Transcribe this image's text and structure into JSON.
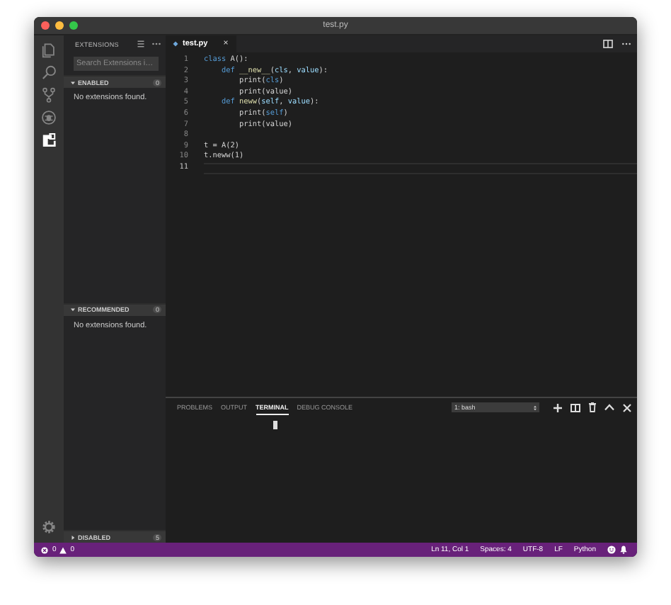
{
  "window": {
    "title": "test.py"
  },
  "activity_bar": {
    "items": [
      {
        "kind": "files",
        "selected": false
      },
      {
        "kind": "search",
        "selected": false
      },
      {
        "kind": "git",
        "selected": false
      },
      {
        "kind": "debug",
        "selected": false
      },
      {
        "kind": "extensions",
        "selected": true
      }
    ]
  },
  "sidebar": {
    "title": "EXTENSIONS",
    "search": {
      "placeholder": "Search Extensions i…"
    },
    "sections": [
      {
        "label": "ENABLED",
        "count": "0",
        "expanded": true,
        "message": "No extensions found."
      },
      {
        "label": "RECOMMENDED",
        "count": "0",
        "expanded": true,
        "message": "No extensions found."
      },
      {
        "label": "DISABLED",
        "count": "5",
        "expanded": false
      }
    ]
  },
  "editor": {
    "tabs": [
      {
        "label": "test.py",
        "close": "×",
        "selected": true
      }
    ],
    "lines": [
      {
        "number": "1",
        "tokens": [
          {
            "text": "class",
            "kind": "keyword"
          },
          {
            "text": " A():",
            "kind": "plain"
          }
        ]
      },
      {
        "number": "2",
        "tokens": [
          {
            "text": "    def",
            "kind": "keyword"
          },
          {
            "text": " __new__",
            "kind": "function"
          },
          {
            "text": "(",
            "kind": "plain"
          },
          {
            "text": "cls",
            "kind": "param"
          },
          {
            "text": ", ",
            "kind": "plain"
          },
          {
            "text": "value",
            "kind": "param"
          },
          {
            "text": "):",
            "kind": "plain"
          }
        ]
      },
      {
        "number": "3",
        "tokens": [
          {
            "text": "        print(",
            "kind": "plain"
          },
          {
            "text": "cls",
            "kind": "self"
          },
          {
            "text": ")",
            "kind": "plain"
          }
        ]
      },
      {
        "number": "4",
        "tokens": [
          {
            "text": "        print(value)",
            "kind": "plain"
          }
        ]
      },
      {
        "number": "5",
        "tokens": [
          {
            "text": "    def",
            "kind": "keyword"
          },
          {
            "text": " neww",
            "kind": "function"
          },
          {
            "text": "(",
            "kind": "plain"
          },
          {
            "text": "self",
            "kind": "param"
          },
          {
            "text": ", ",
            "kind": "plain"
          },
          {
            "text": "value",
            "kind": "param"
          },
          {
            "text": "):",
            "kind": "plain"
          }
        ]
      },
      {
        "number": "6",
        "tokens": [
          {
            "text": "        print(",
            "kind": "plain"
          },
          {
            "text": "self",
            "kind": "self"
          },
          {
            "text": ")",
            "kind": "plain"
          }
        ]
      },
      {
        "number": "7",
        "tokens": [
          {
            "text": "        print(value)",
            "kind": "plain"
          }
        ]
      },
      {
        "number": "8"
      },
      {
        "number": "9",
        "tokens": [
          {
            "text": "t = A(2)",
            "kind": "plain"
          }
        ]
      },
      {
        "number": "10",
        "tokens": [
          {
            "text": "t.neww(1)",
            "kind": "plain"
          }
        ]
      },
      {
        "number": "11",
        "current": true
      }
    ]
  },
  "panel": {
    "tabs": [
      {
        "label": "PROBLEMS",
        "selected": false
      },
      {
        "label": "OUTPUT",
        "selected": false
      },
      {
        "label": "TERMINAL",
        "selected": true
      },
      {
        "label": "DEBUG CONSOLE",
        "selected": false
      }
    ],
    "terminal_select": "1: bash"
  },
  "status_bar": {
    "errors": "0",
    "warnings": "0",
    "items": [
      "Ln 11, Col 1",
      "Spaces: 4",
      "UTF-8",
      "LF",
      "Python"
    ]
  }
}
